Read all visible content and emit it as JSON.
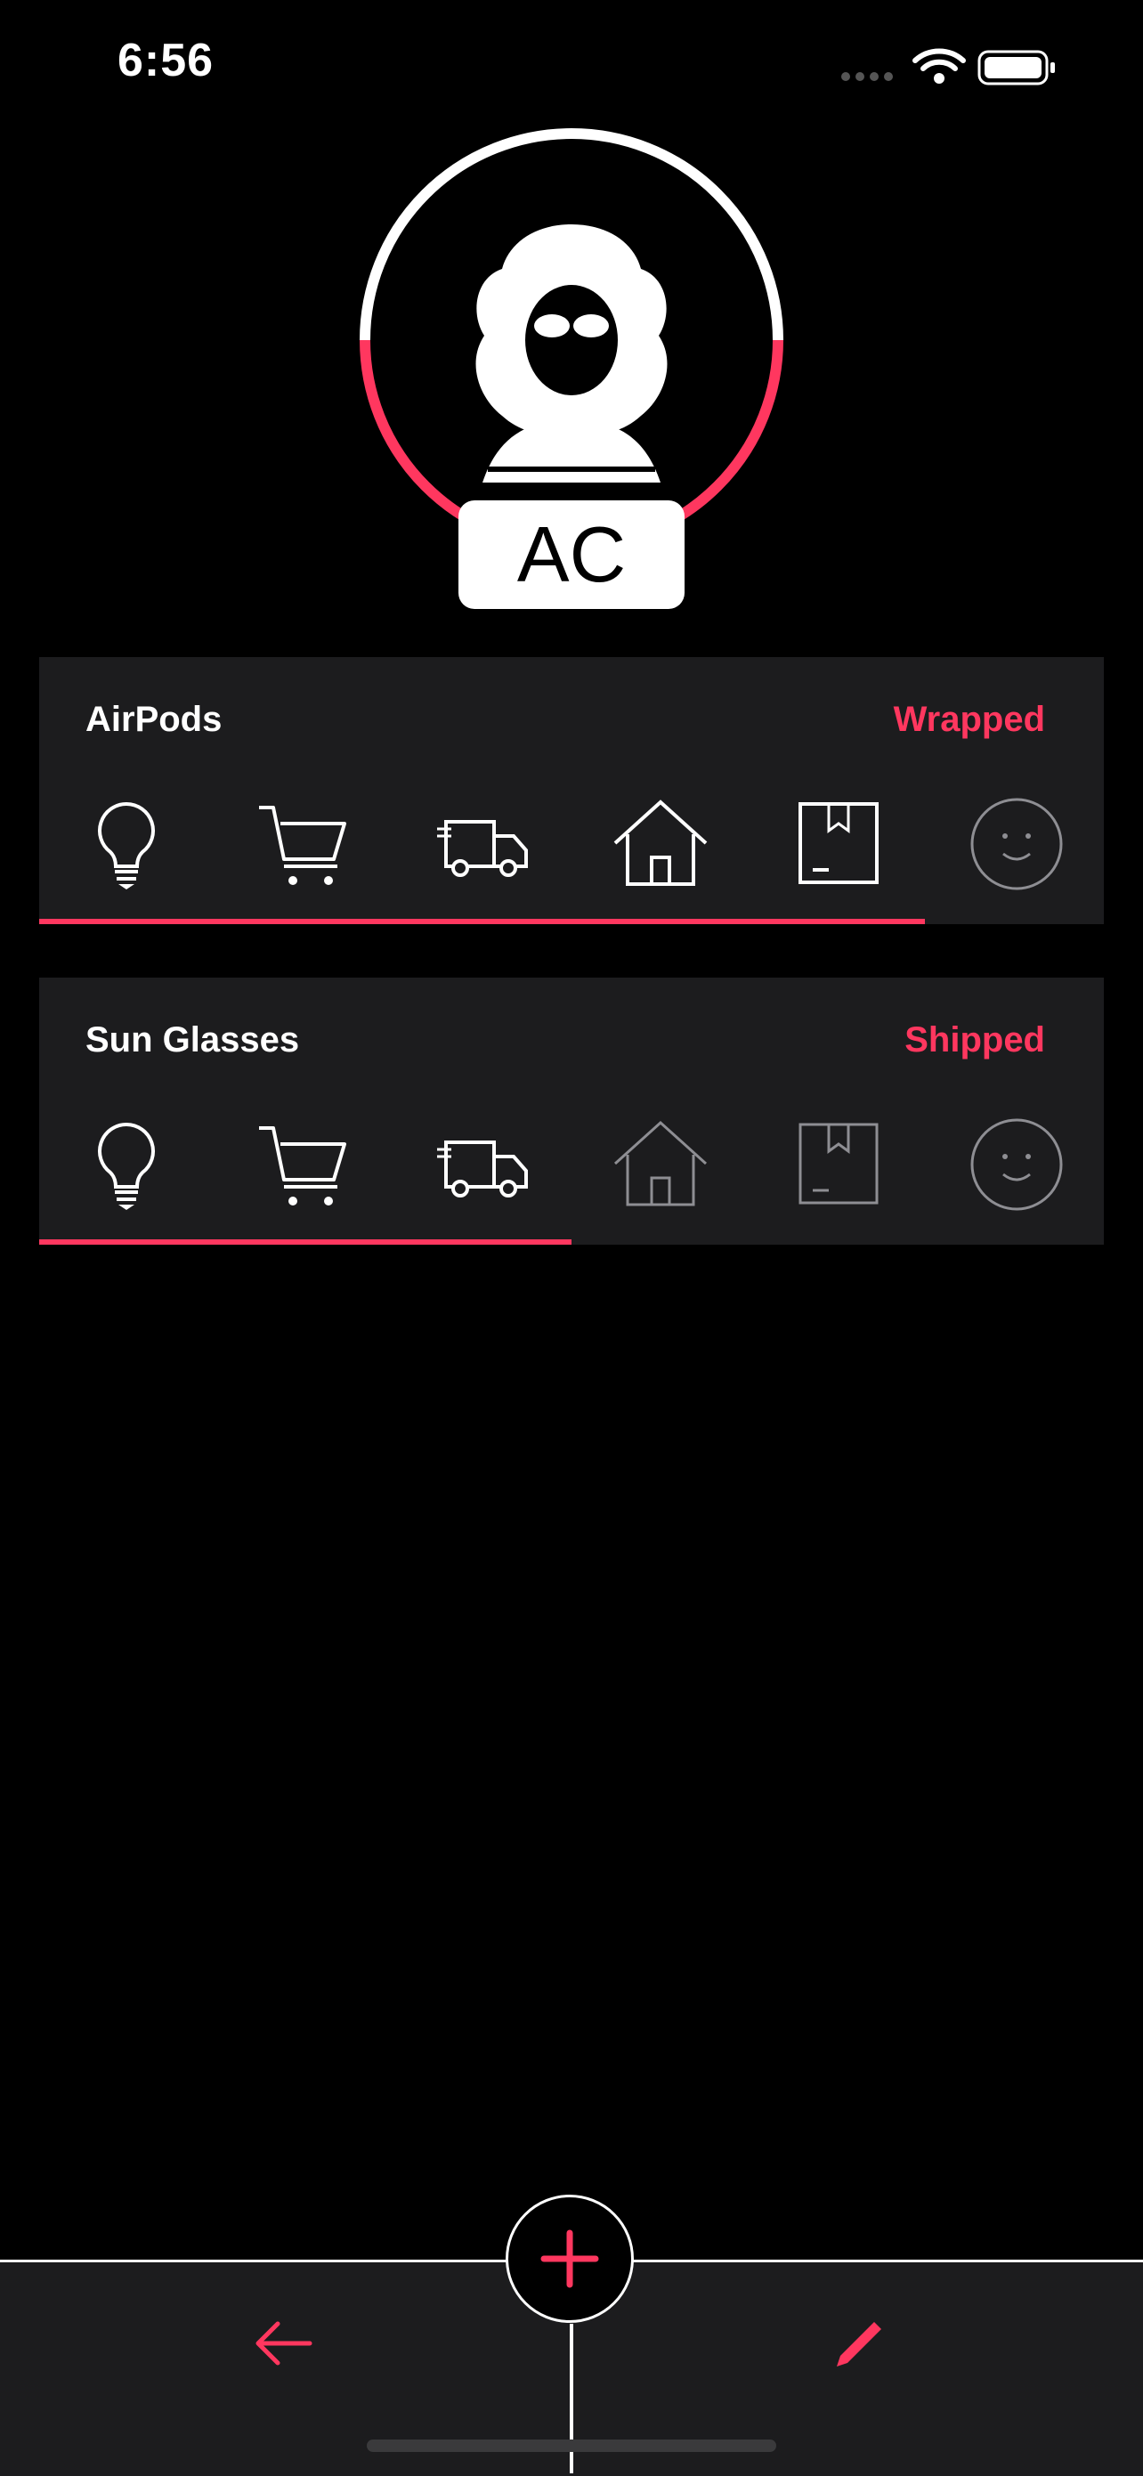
{
  "status_bar": {
    "time": "6:56"
  },
  "profile": {
    "initials": "AC",
    "ring_color": "#ff375f"
  },
  "orders": [
    {
      "name": "AirPods",
      "status": "Wrapped",
      "steps_completed": 5,
      "progress_fraction": 0.835
    },
    {
      "name": "Sun Glasses",
      "status": "Shipped",
      "steps_completed": 3,
      "progress_fraction": 0.5
    }
  ],
  "step_icons": [
    "lightbulb-icon",
    "cart-icon",
    "truck-icon",
    "house-icon",
    "box-icon",
    "smiley-icon"
  ],
  "colors": {
    "accent": "#ff375f",
    "card": "#1c1c1e",
    "inactive": "#8e8e93"
  },
  "toolbar": {
    "left": "arrow-left-icon",
    "center": "plus-icon",
    "right": "pencil-icon"
  }
}
